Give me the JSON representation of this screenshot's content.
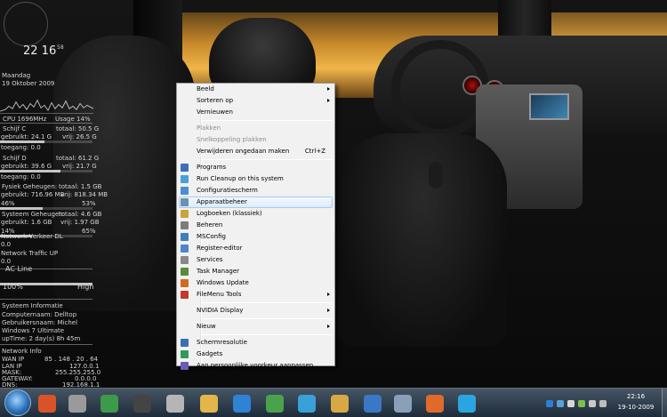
{
  "widgets": {
    "clock": {
      "time": "22 16",
      "seconds": "58"
    },
    "date": {
      "day": "Maandag",
      "full": "19 Oktober 2009"
    },
    "cpu": {
      "label": "CPU 1696MHz",
      "usage": "Usage 14%",
      "usage_value": 0.14
    },
    "drive_c": {
      "label": "Schijf C",
      "total": "totaal: 50.5 G",
      "used": "gebruikt: 24.1 G",
      "free": "vrij: 26.5 G",
      "access": "toegang: 0.0",
      "fill": 0.48
    },
    "drive_d": {
      "label": "Schijf D",
      "total": "totaal: 61.2 G",
      "used": "gebruikt: 39.6 G",
      "free": "vrij: 21.7 G",
      "access": "toegang: 0.0",
      "fill": 0.65
    },
    "physical_memory": {
      "label": "Fysiek Geheugen:",
      "total": "totaal: 1.5 GB",
      "used": "gebruikt: 716.96 MB",
      "free": "vrij: 818.34 MB",
      "pct_left": "46%",
      "pct_right": "53%",
      "fill": 0.46
    },
    "system_memory": {
      "label": "Systeem Geheugen:",
      "total": "totaal: 4.6 GB",
      "used": "gebruikt: 1.6 GB",
      "free": "vrij: 1.97 GB",
      "pct_left": "14%",
      "pct_right": "65%",
      "fill": 0.35
    },
    "network_dl": {
      "label": "Network Verkeer DL",
      "value": "0.0"
    },
    "network_up": {
      "label": "Network Traffic UP",
      "value": "0.0"
    },
    "power": {
      "label": "AC Line",
      "pct": "100%",
      "level": "High",
      "fill": 1.0
    },
    "system_info": {
      "title": "Systeem Informatie",
      "computer": "Computernaam: Delltop",
      "user": "Gebruikersnaam: Michel",
      "os": "Windows 7 Ultimate",
      "uptime": "upTime: 2 day(s) 8h 45m"
    },
    "network_info": {
      "title": "Network Info",
      "rows": [
        {
          "k": "WAN IP",
          "v": "85 . 148 . 20 . 64"
        },
        {
          "k": "LAN IP",
          "v": "127.0.0.1"
        },
        {
          "k": "MASK:",
          "v": "255.255.255.0"
        },
        {
          "k": "GATEWAY:",
          "v": "0.0.0.0"
        },
        {
          "k": "DNS:",
          "v": "192.168.1.1"
        }
      ]
    }
  },
  "context_menu": {
    "items": [
      {
        "label": "Beeld",
        "submenu": true
      },
      {
        "label": "Sorteren op",
        "submenu": true
      },
      {
        "label": "Vernieuwen"
      },
      {
        "sep": true
      },
      {
        "label": "Plakken",
        "disabled": true
      },
      {
        "label": "Snelkoppeling plakken",
        "disabled": true
      },
      {
        "label": "Verwijderen ongedaan maken",
        "shortcut": "Ctrl+Z"
      },
      {
        "sep": true
      },
      {
        "label": "Programs",
        "icon": "programs-icon",
        "color": "#3b6fb6"
      },
      {
        "label": "Run Cleanup on this system",
        "icon": "cleanup-icon",
        "color": "#4aa0d8"
      },
      {
        "label": "Configuratiescherm",
        "icon": "control-panel-icon",
        "color": "#4b8ed3"
      },
      {
        "label": "Apparaatbeheer",
        "icon": "device-manager-icon",
        "color": "#6d8fb0",
        "highlight": true
      },
      {
        "label": "Logboeken (klassiek)",
        "icon": "event-log-icon",
        "color": "#c9a33b"
      },
      {
        "label": "Beheren",
        "icon": "manage-icon",
        "color": "#7d7d7d"
      },
      {
        "label": "MSConfig",
        "icon": "msconfig-icon",
        "color": "#3f7fbf"
      },
      {
        "label": "Register-editor",
        "icon": "registry-icon",
        "color": "#4f86c6"
      },
      {
        "label": "Services",
        "icon": "services-icon",
        "color": "#8a8a8a"
      },
      {
        "label": "Task Manager",
        "icon": "task-manager-icon",
        "color": "#5a8a3c"
      },
      {
        "label": "Windows Update",
        "icon": "windows-update-icon",
        "color": "#d06b1f"
      },
      {
        "label": "FileMenu Tools",
        "icon": "filemenu-icon",
        "color": "#c23b2a",
        "submenu": true
      },
      {
        "sep": true
      },
      {
        "label": "NVIDIA Display",
        "submenu": true
      },
      {
        "sep": true
      },
      {
        "label": "Nieuw",
        "submenu": true
      },
      {
        "sep": true
      },
      {
        "label": "Schermresolutie",
        "icon": "screen-resolution-icon",
        "color": "#3a6fb5"
      },
      {
        "label": "Gadgets",
        "icon": "gadgets-icon",
        "color": "#2f9a5a"
      },
      {
        "label": "Aan persoonlijke voorkeur aanpassen",
        "icon": "personalize-icon",
        "color": "#6a5bb5"
      }
    ]
  },
  "taskbar": {
    "buttons": [
      {
        "name": "taskbar-firefox-orb-icon",
        "color": "#d9532a"
      },
      {
        "name": "taskbar-car-icon",
        "color": "#9a9a9a"
      },
      {
        "name": "taskbar-app-icon",
        "color": "#3d9a4a"
      },
      {
        "name": "taskbar-film-icon",
        "color": "#444444"
      },
      {
        "name": "taskbar-media-icon",
        "color": "#b5b5b5"
      },
      {
        "name": "taskbar-folder-icon",
        "color": "#e2b64a"
      },
      {
        "name": "taskbar-ie-icon",
        "color": "#2f82d4"
      },
      {
        "name": "taskbar-chrome-icon",
        "color": "#4aa24a"
      },
      {
        "name": "taskbar-messenger-icon",
        "color": "#39a0d8"
      },
      {
        "name": "taskbar-explorer-icon",
        "color": "#d7a844"
      },
      {
        "name": "taskbar-windows-icon",
        "color": "#3a78c5"
      },
      {
        "name": "taskbar-docs-icon",
        "color": "#8aa0b8"
      },
      {
        "name": "taskbar-firefox-icon",
        "color": "#e06a2a"
      },
      {
        "name": "taskbar-skype-icon",
        "color": "#2aa5e0"
      }
    ],
    "clock": {
      "time": "22:16",
      "date": "19-10-2009"
    }
  }
}
